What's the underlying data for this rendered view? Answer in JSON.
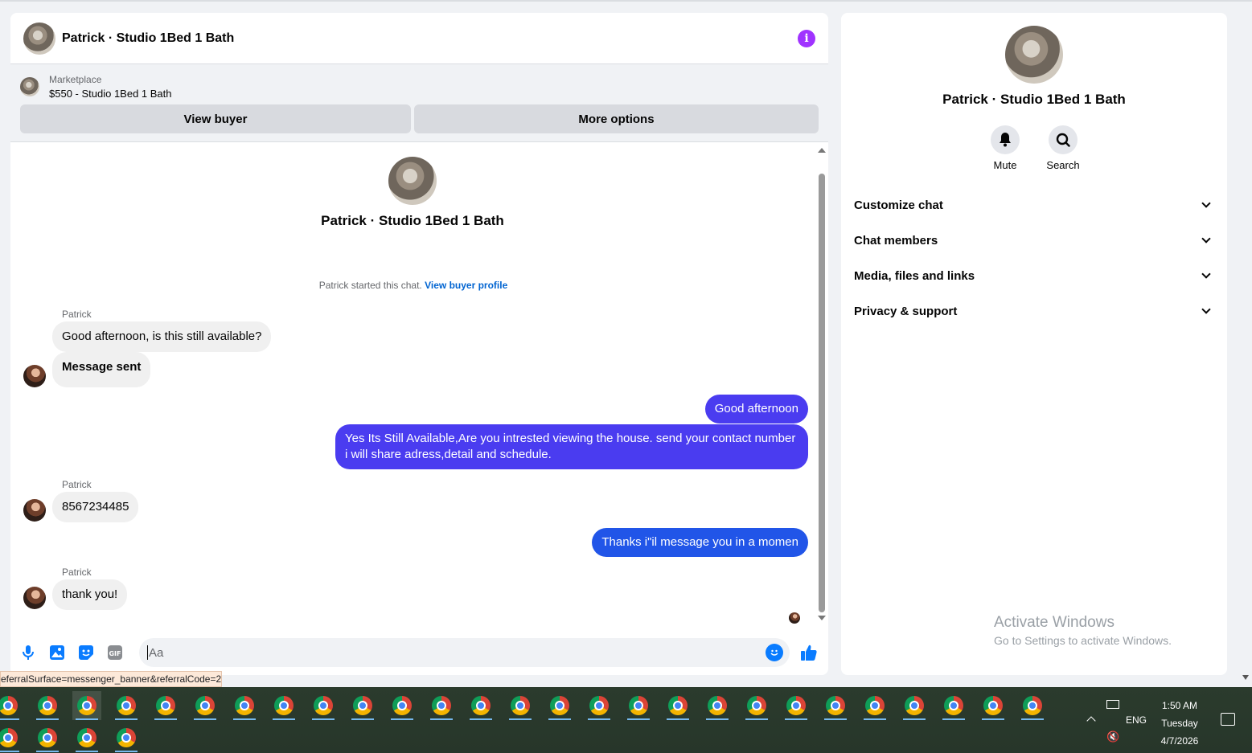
{
  "chat": {
    "title": "Patrick · Studio 1Bed 1 Bath",
    "info_icon": "info-icon",
    "marketplace": {
      "label": "Marketplace",
      "listing": "$550 - Studio 1Bed 1 Bath",
      "view_buyer": "View buyer",
      "more_options": "More options"
    },
    "intro_name": "Patrick · Studio 1Bed 1 Bath",
    "started_text": "Patrick started this chat. ",
    "started_link": "View buyer profile",
    "messages": [
      {
        "sender": "Patrick",
        "text": "Good afternoon, is this still available?",
        "dir": "in"
      },
      {
        "text": "Message sent",
        "dir": "in"
      },
      {
        "text": "Good afternoon",
        "dir": "out"
      },
      {
        "text": "Yes Its Still Available,Are you intrested viewing the house. send your contact number i will share adress,detail and schedule.",
        "dir": "out"
      },
      {
        "sender": "Patrick",
        "text": "8567234485",
        "dir": "in"
      },
      {
        "text": "Thanks i\"il message you in a momen",
        "dir": "out"
      },
      {
        "sender": "Patrick",
        "text": "thank you!",
        "dir": "in"
      }
    ],
    "composer_placeholder": "Aa"
  },
  "status_url": "eferralSurface=messenger_banner&referralCode=2",
  "side": {
    "name": "Patrick · Studio 1Bed 1 Bath",
    "mute": "Mute",
    "search": "Search",
    "sections": [
      "Customize chat",
      "Chat members",
      "Media, files and links",
      "Privacy & support"
    ]
  },
  "watermark": {
    "line1": "Activate Windows",
    "line2": "Go to Settings to activate Windows."
  },
  "taskbar": {
    "lang": "ENG",
    "time": "1:50 AM",
    "day": "Tuesday",
    "date": "4/7/2026"
  },
  "colors": {
    "accent_purple": "#4a3cf0",
    "accent_blue": "#2155e8",
    "info_purple": "#a033ff",
    "messenger_blue": "#0a7cff"
  }
}
